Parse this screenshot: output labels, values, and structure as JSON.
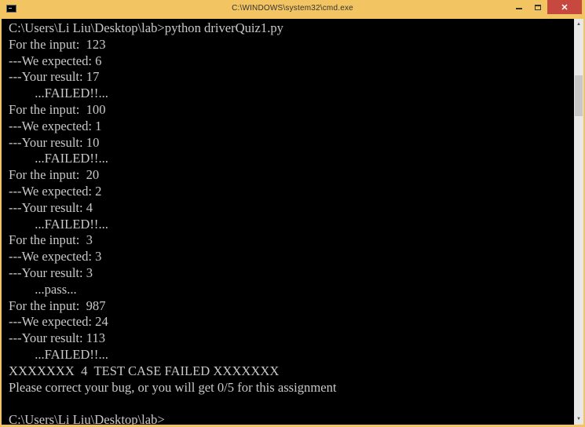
{
  "window": {
    "title": "C:\\WINDOWS\\system32\\cmd.exe",
    "icon": "cmd-icon",
    "controls": {
      "minimize": "minimize-icon",
      "maximize": "maximize-icon",
      "close": "close-icon"
    },
    "close_glyph": "✕",
    "colors": {
      "frame": "#f3c462",
      "close": "#c7483e",
      "console_bg": "#000000",
      "console_text": "#c9c9c9"
    }
  },
  "console": {
    "lines": [
      "C:\\Users\\Li Liu\\Desktop\\lab>python driverQuiz1.py",
      "For the input:  123",
      "---We expected: 6",
      "---Your result: 17",
      "        ...FAILED!!...",
      "For the input:  100",
      "---We expected: 1",
      "---Your result: 10",
      "        ...FAILED!!...",
      "For the input:  20",
      "---We expected: 2",
      "---Your result: 4",
      "        ...FAILED!!...",
      "For the input:  3",
      "---We expected: 3",
      "---Your result: 3",
      "        ...pass...",
      "For the input:  987",
      "---We expected: 24",
      "---Your result: 113",
      "        ...FAILED!!...",
      "XXXXXXX  4  TEST CASE FAILED XXXXXXX",
      "Please correct your bug, or you will get 0/5 for this assignment",
      "",
      "C:\\Users\\Li Liu\\Desktop\\lab>"
    ]
  },
  "scrollbar": {
    "up_arrow": "▲",
    "down_arrow": "▼"
  }
}
